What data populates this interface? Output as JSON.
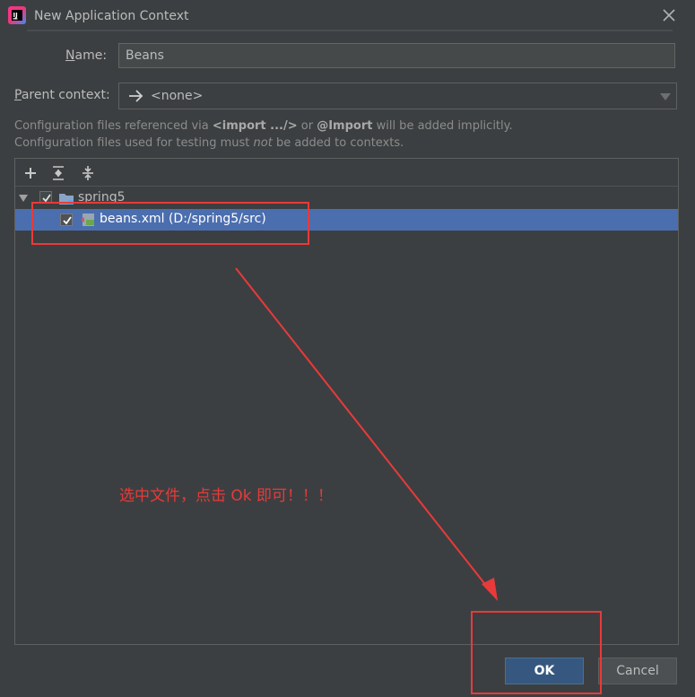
{
  "window": {
    "title": "New Application Context",
    "logo_icon": "intellij-logo-icon",
    "close_icon": "close-icon"
  },
  "form": {
    "name_label_key": "N",
    "name_label_rest": "ame:",
    "name_value": "Beans",
    "parent_label_key": "P",
    "parent_label_rest": "arent context:",
    "parent_value": "<none>"
  },
  "hints": {
    "line1_a": "Configuration files referenced via ",
    "line1_b": "<import .../>",
    "line1_c": " or ",
    "line1_d": "@Import",
    "line1_e": " will be added implicitly.",
    "line2_a": "Configuration files used for testing must ",
    "line2_b": "not",
    "line2_c": " be added to contexts."
  },
  "toolbar": {
    "add_icon": "add-icon",
    "expand_all_icon": "expand-all-icon",
    "collapse_all_icon": "collapse-all-icon"
  },
  "tree": {
    "root_label": "spring5",
    "root_checked": true,
    "child_label": "beans.xml (D:/spring5/src)",
    "child_checked": true,
    "child_selected": true
  },
  "annotation": {
    "text": "选中文件，点击 Ok 即可！！！",
    "color": "#e83a3a"
  },
  "buttons": {
    "ok": "OK",
    "cancel": "Cancel"
  },
  "colors": {
    "background": "#3c3f41",
    "selection": "#4b6eaf",
    "ok_button": "#365880"
  }
}
